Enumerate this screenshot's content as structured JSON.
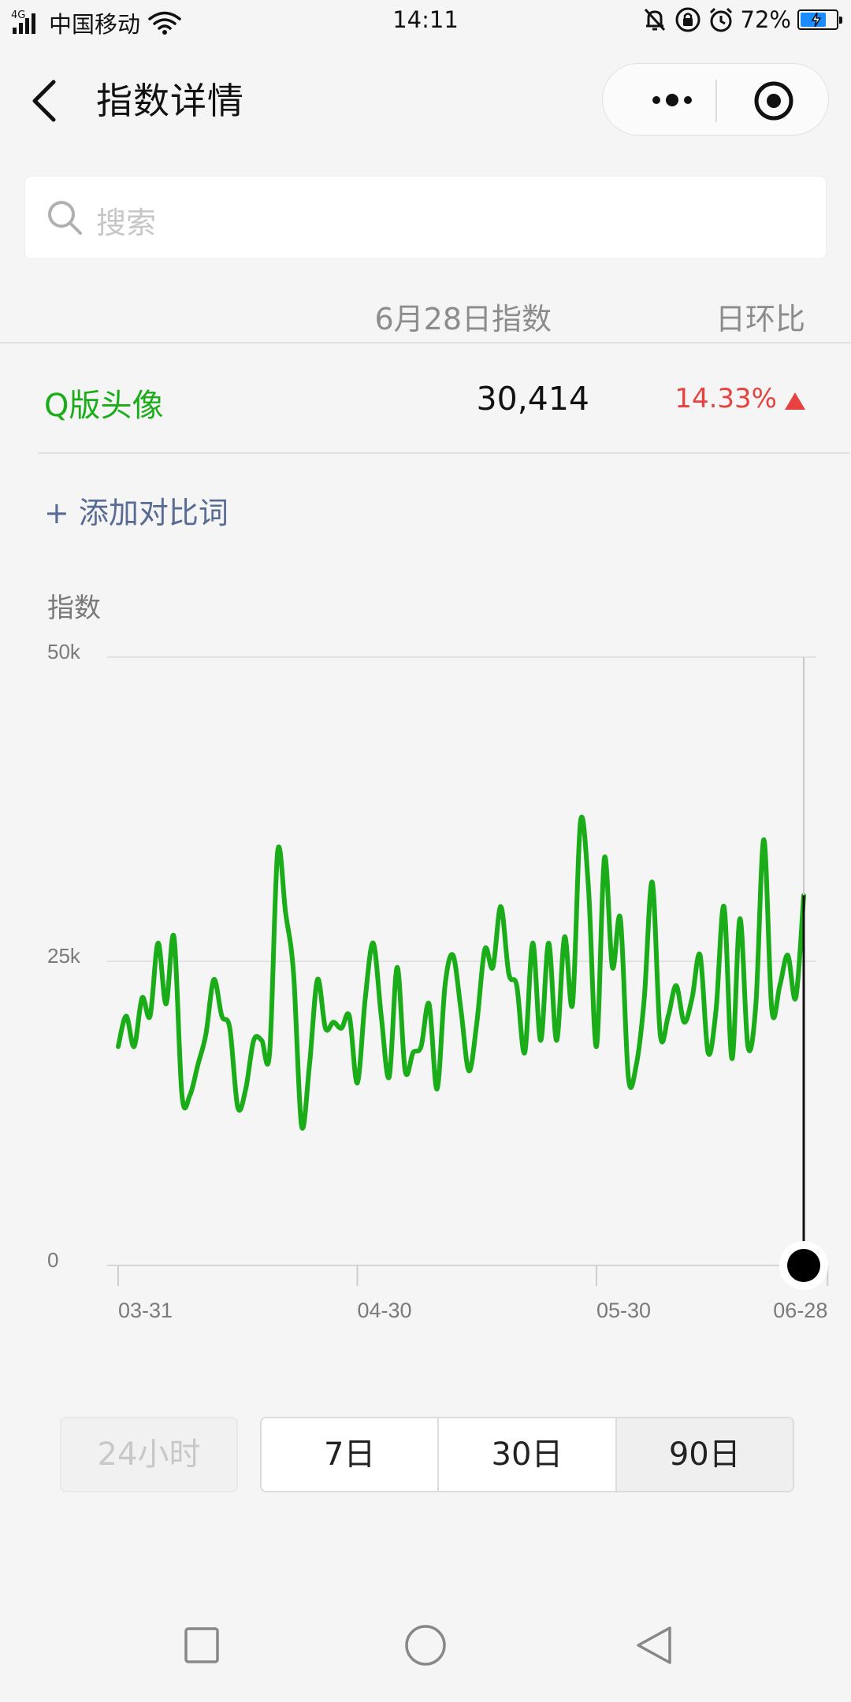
{
  "status_bar": {
    "network": "4G",
    "carrier": "中国移动",
    "time": "14:11",
    "battery": "72%",
    "battery_level": 0.72
  },
  "header": {
    "title": "指数详情"
  },
  "search": {
    "placeholder": "搜索"
  },
  "table": {
    "col_index": "6月28日指数",
    "col_change": "日环比",
    "row": {
      "keyword": "Q版头像",
      "value": "30,414",
      "change": "14.33%"
    }
  },
  "add_compare": "+ 添加对比词",
  "chart_label": "指数",
  "chart_data": {
    "type": "line",
    "ylabel": "指数",
    "ylim": [
      0,
      50000
    ],
    "y_ticks": [
      "50k",
      "25k",
      "0"
    ],
    "x_ticks": [
      "03-31",
      "04-30",
      "05-30",
      "06-28"
    ],
    "x": [
      "03-31",
      "04-01",
      "04-02",
      "04-03",
      "04-04",
      "04-05",
      "04-06",
      "04-07",
      "04-08",
      "04-09",
      "04-10",
      "04-11",
      "04-12",
      "04-13",
      "04-14",
      "04-15",
      "04-16",
      "04-17",
      "04-18",
      "04-19",
      "04-20",
      "04-21",
      "04-22",
      "04-23",
      "04-24",
      "04-25",
      "04-26",
      "04-27",
      "04-28",
      "04-29",
      "04-30",
      "05-01",
      "05-02",
      "05-03",
      "05-04",
      "05-05",
      "05-06",
      "05-07",
      "05-08",
      "05-09",
      "05-10",
      "05-11",
      "05-12",
      "05-13",
      "05-14",
      "05-15",
      "05-16",
      "05-17",
      "05-18",
      "05-19",
      "05-20",
      "05-21",
      "05-22",
      "05-23",
      "05-24",
      "05-25",
      "05-26",
      "05-27",
      "05-28",
      "05-29",
      "05-30",
      "05-31",
      "06-01",
      "06-02",
      "06-03",
      "06-04",
      "06-05",
      "06-06",
      "06-07",
      "06-08",
      "06-09",
      "06-10",
      "06-11",
      "06-12",
      "06-13",
      "06-14",
      "06-15",
      "06-16",
      "06-17",
      "06-18",
      "06-19",
      "06-20",
      "06-21",
      "06-22",
      "06-23",
      "06-24",
      "06-25",
      "06-26",
      "06-27",
      "06-28"
    ],
    "series": [
      {
        "color": "#1aad19",
        "values": [
          18000,
          20500,
          18000,
          22000,
          20500,
          26500,
          21500,
          27000,
          14000,
          14000,
          16500,
          19000,
          23500,
          20500,
          19500,
          13000,
          14500,
          18500,
          18500,
          17500,
          34000,
          29000,
          24000,
          11500,
          16500,
          23500,
          19500,
          20000,
          19500,
          20500,
          15000,
          22000,
          26500,
          20500,
          15500,
          24500,
          16000,
          17500,
          18000,
          21500,
          14500,
          23000,
          25500,
          21000,
          16000,
          20000,
          26000,
          24500,
          29500,
          24000,
          23000,
          17500,
          26500,
          18500,
          26500,
          18500,
          27000,
          21500,
          36500,
          31000,
          18000,
          33500,
          24500,
          28500,
          15500,
          16500,
          22000,
          31500,
          19000,
          20500,
          23000,
          20000,
          22000,
          25500,
          17500,
          21000,
          29500,
          17000,
          28500,
          18000,
          21500,
          35000,
          21000,
          23000,
          25500,
          22000,
          30414
        ]
      }
    ]
  }
}
